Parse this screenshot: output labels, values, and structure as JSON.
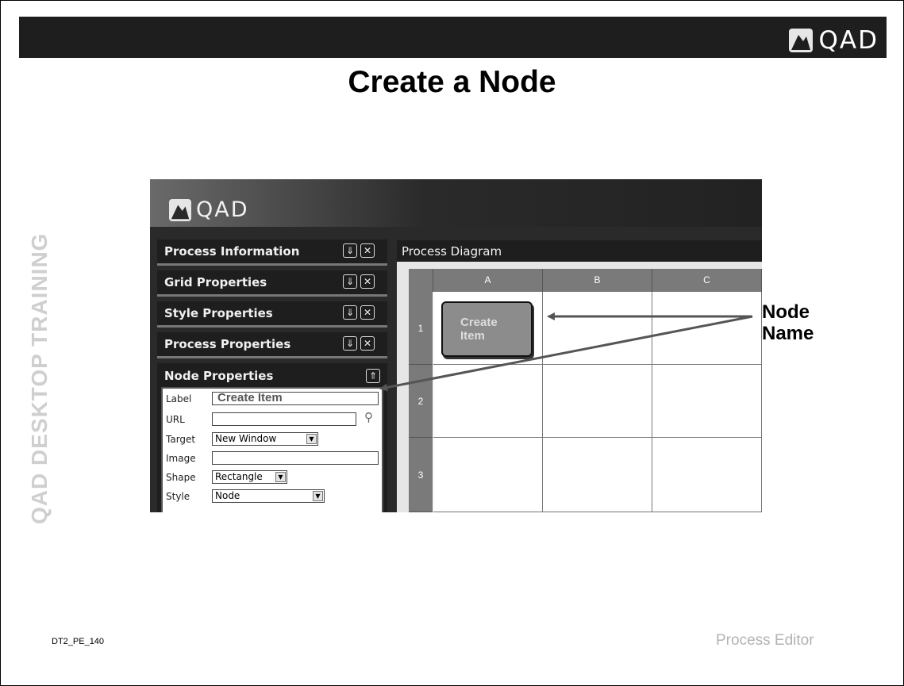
{
  "slide": {
    "brand": "QAD",
    "title": "Create a Node",
    "side_label": "QAD DESKTOP TRAINING",
    "footer_code": "DT2_PE_140",
    "footer_section": "Process Editor"
  },
  "app": {
    "brand": "QAD",
    "panels": [
      {
        "title": "Process Information"
      },
      {
        "title": "Grid Properties"
      },
      {
        "title": "Style Properties"
      },
      {
        "title": "Process Properties"
      }
    ],
    "node_properties": {
      "title": "Node Properties",
      "fields": {
        "label": {
          "label": "Label",
          "value": "Create Item"
        },
        "url": {
          "label": "URL",
          "value": ""
        },
        "target": {
          "label": "Target",
          "value": "New Window"
        },
        "image": {
          "label": "Image",
          "value": ""
        },
        "shape": {
          "label": "Shape",
          "value": "Rectangle"
        },
        "style": {
          "label": "Style",
          "value": "Node"
        }
      }
    },
    "diagram": {
      "title": "Process Diagram",
      "columns": [
        "A",
        "B",
        "C"
      ],
      "rows": [
        "1",
        "2",
        "3"
      ],
      "node_label": "Create\nItem"
    }
  },
  "callout": {
    "line1": "Node",
    "line2": "Name"
  },
  "icons": [
    "qad-logo-icon",
    "expand-icon",
    "close-icon",
    "collapse-icon",
    "lookup-icon",
    "dropdown-arrow-icon"
  ]
}
